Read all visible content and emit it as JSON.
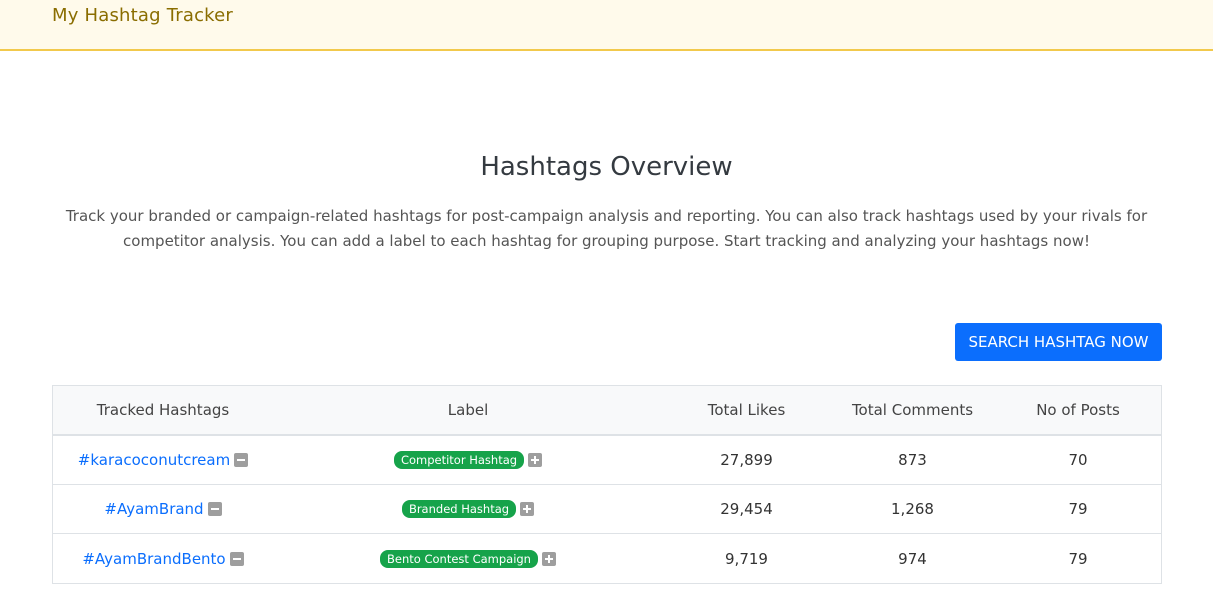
{
  "header": {
    "brand": "My Hashtag Tracker"
  },
  "main": {
    "title": "Hashtags Overview",
    "description": "Track your branded or campaign-related hashtags for post-campaign analysis and reporting. You can also track hashtags used by your rivals for competitor analysis. You can add a label to each hashtag for grouping purpose. Start tracking and analyzing your hashtags now!",
    "search_button": "SEARCH HASHTAG NOW"
  },
  "table": {
    "columns": [
      "Tracked Hashtags",
      "Label",
      "Total Likes",
      "Total Comments",
      "No of Posts"
    ],
    "rows": [
      {
        "hashtag": "#karacoconutcream",
        "label": "Competitor Hashtag",
        "likes": "27,899",
        "comments": "873",
        "posts": "70"
      },
      {
        "hashtag": "#AyamBrand",
        "label": "Branded Hashtag",
        "likes": "29,454",
        "comments": "1,268",
        "posts": "79"
      },
      {
        "hashtag": "#AyamBrandBento",
        "label": "Bento Contest Campaign",
        "likes": "9,719",
        "comments": "974",
        "posts": "79"
      }
    ]
  },
  "colors": {
    "accent": "#0b6efd",
    "badge": "#16a34a",
    "header_bg": "#fffaeb",
    "header_border": "#f2c94c"
  }
}
